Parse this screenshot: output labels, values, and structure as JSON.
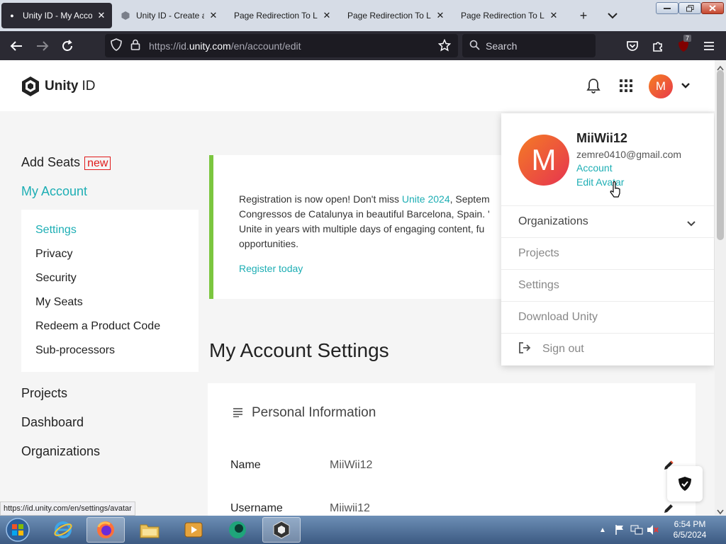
{
  "browser": {
    "tabs": [
      {
        "title": "Unity ID - My Account",
        "active": true
      },
      {
        "title": "Unity ID - Create a Unity ID",
        "active": false
      },
      {
        "title": "Page Redirection To Login",
        "active": false
      },
      {
        "title": "Page Redirection To Login",
        "active": false
      },
      {
        "title": "Page Redirection To Login",
        "active": false
      }
    ],
    "new_tab": "+",
    "url_prefix": "https://id.",
    "url_domain": "unity.com",
    "url_path": "/en/account/edit",
    "search_placeholder": "Search",
    "extension_badge": "7"
  },
  "header": {
    "logo_text": "Unity",
    "logo_suffix": "ID",
    "avatar_initial": "M"
  },
  "sidebar": {
    "add_seats": "Add Seats",
    "new_badge": "new",
    "my_account": "My Account",
    "sub_items": [
      "Settings",
      "Privacy",
      "Security",
      "My Seats",
      "Redeem a Product Code",
      "Sub-processors"
    ],
    "projects": "Projects",
    "dashboard": "Dashboard",
    "organizations": "Organizations"
  },
  "banner": {
    "line1_pre": "Registration is now open! Don't miss ",
    "line1_link": "Unite 2024",
    "line1_post": ", Septem",
    "line2": "Congressos de Catalunya in beautiful Barcelona, Spain. '",
    "line3": "Unite in years with multiple days of engaging content, fu",
    "line4": "opportunities.",
    "register": "Register today"
  },
  "main": {
    "title": "My Account Settings",
    "personal_info": "Personal Information",
    "name_label": "Name",
    "name_value": "MiiWii12",
    "username_label": "Username",
    "username_value": "Miiwii12"
  },
  "dropdown": {
    "avatar_initial": "M",
    "username": "MiiWii12",
    "email": "zemre0410@gmail.com",
    "account": "Account",
    "edit_avatar": "Edit Avatar",
    "organizations": "Organizations",
    "projects": "Projects",
    "settings": "Settings",
    "download": "Download Unity",
    "sign_out": "Sign out"
  },
  "status_url": "https://id.unity.com/en/settings/avatar",
  "taskbar": {
    "time": "6:54 PM",
    "date": "6/5/2024"
  }
}
